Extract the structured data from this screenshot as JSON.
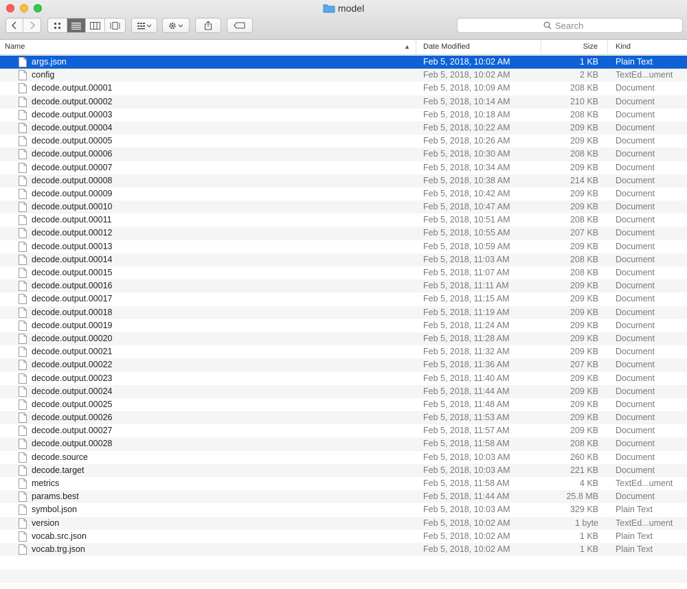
{
  "window": {
    "title": "model",
    "colors": {
      "selection": "#0f62d5",
      "close": "#fc605c",
      "minimize": "#fdbc40",
      "maximize": "#34c84a"
    }
  },
  "toolbar": {
    "back_icon": "chevron-left-icon",
    "forward_icon": "chevron-right-icon",
    "view_modes": [
      "icon-view-icon",
      "list-view-icon",
      "column-view-icon",
      "cover-flow-icon"
    ],
    "active_view": "list",
    "search_placeholder": "Search"
  },
  "columns": {
    "name": "Name",
    "date": "Date Modified",
    "size": "Size",
    "kind": "Kind"
  },
  "files": [
    {
      "name": "args.json",
      "date": "Feb 5, 2018, 10:02 AM",
      "size": "1 KB",
      "kind": "Plain Text",
      "selected": true
    },
    {
      "name": "config",
      "date": "Feb 5, 2018, 10:02 AM",
      "size": "2 KB",
      "kind": "TextEd...ument"
    },
    {
      "name": "decode.output.00001",
      "date": "Feb 5, 2018, 10:09 AM",
      "size": "208 KB",
      "kind": "Document"
    },
    {
      "name": "decode.output.00002",
      "date": "Feb 5, 2018, 10:14 AM",
      "size": "210 KB",
      "kind": "Document"
    },
    {
      "name": "decode.output.00003",
      "date": "Feb 5, 2018, 10:18 AM",
      "size": "208 KB",
      "kind": "Document"
    },
    {
      "name": "decode.output.00004",
      "date": "Feb 5, 2018, 10:22 AM",
      "size": "209 KB",
      "kind": "Document"
    },
    {
      "name": "decode.output.00005",
      "date": "Feb 5, 2018, 10:26 AM",
      "size": "209 KB",
      "kind": "Document"
    },
    {
      "name": "decode.output.00006",
      "date": "Feb 5, 2018, 10:30 AM",
      "size": "208 KB",
      "kind": "Document"
    },
    {
      "name": "decode.output.00007",
      "date": "Feb 5, 2018, 10:34 AM",
      "size": "209 KB",
      "kind": "Document"
    },
    {
      "name": "decode.output.00008",
      "date": "Feb 5, 2018, 10:38 AM",
      "size": "214 KB",
      "kind": "Document"
    },
    {
      "name": "decode.output.00009",
      "date": "Feb 5, 2018, 10:42 AM",
      "size": "209 KB",
      "kind": "Document"
    },
    {
      "name": "decode.output.00010",
      "date": "Feb 5, 2018, 10:47 AM",
      "size": "209 KB",
      "kind": "Document"
    },
    {
      "name": "decode.output.00011",
      "date": "Feb 5, 2018, 10:51 AM",
      "size": "208 KB",
      "kind": "Document"
    },
    {
      "name": "decode.output.00012",
      "date": "Feb 5, 2018, 10:55 AM",
      "size": "207 KB",
      "kind": "Document"
    },
    {
      "name": "decode.output.00013",
      "date": "Feb 5, 2018, 10:59 AM",
      "size": "209 KB",
      "kind": "Document"
    },
    {
      "name": "decode.output.00014",
      "date": "Feb 5, 2018, 11:03 AM",
      "size": "208 KB",
      "kind": "Document"
    },
    {
      "name": "decode.output.00015",
      "date": "Feb 5, 2018, 11:07 AM",
      "size": "208 KB",
      "kind": "Document"
    },
    {
      "name": "decode.output.00016",
      "date": "Feb 5, 2018, 11:11 AM",
      "size": "209 KB",
      "kind": "Document"
    },
    {
      "name": "decode.output.00017",
      "date": "Feb 5, 2018, 11:15 AM",
      "size": "209 KB",
      "kind": "Document"
    },
    {
      "name": "decode.output.00018",
      "date": "Feb 5, 2018, 11:19 AM",
      "size": "209 KB",
      "kind": "Document"
    },
    {
      "name": "decode.output.00019",
      "date": "Feb 5, 2018, 11:24 AM",
      "size": "209 KB",
      "kind": "Document"
    },
    {
      "name": "decode.output.00020",
      "date": "Feb 5, 2018, 11:28 AM",
      "size": "209 KB",
      "kind": "Document"
    },
    {
      "name": "decode.output.00021",
      "date": "Feb 5, 2018, 11:32 AM",
      "size": "209 KB",
      "kind": "Document"
    },
    {
      "name": "decode.output.00022",
      "date": "Feb 5, 2018, 11:36 AM",
      "size": "207 KB",
      "kind": "Document"
    },
    {
      "name": "decode.output.00023",
      "date": "Feb 5, 2018, 11:40 AM",
      "size": "209 KB",
      "kind": "Document"
    },
    {
      "name": "decode.output.00024",
      "date": "Feb 5, 2018, 11:44 AM",
      "size": "209 KB",
      "kind": "Document"
    },
    {
      "name": "decode.output.00025",
      "date": "Feb 5, 2018, 11:48 AM",
      "size": "209 KB",
      "kind": "Document"
    },
    {
      "name": "decode.output.00026",
      "date": "Feb 5, 2018, 11:53 AM",
      "size": "209 KB",
      "kind": "Document"
    },
    {
      "name": "decode.output.00027",
      "date": "Feb 5, 2018, 11:57 AM",
      "size": "209 KB",
      "kind": "Document"
    },
    {
      "name": "decode.output.00028",
      "date": "Feb 5, 2018, 11:58 AM",
      "size": "208 KB",
      "kind": "Document"
    },
    {
      "name": "decode.source",
      "date": "Feb 5, 2018, 10:03 AM",
      "size": "260 KB",
      "kind": "Document"
    },
    {
      "name": "decode.target",
      "date": "Feb 5, 2018, 10:03 AM",
      "size": "221 KB",
      "kind": "Document"
    },
    {
      "name": "metrics",
      "date": "Feb 5, 2018, 11:58 AM",
      "size": "4 KB",
      "kind": "TextEd...ument"
    },
    {
      "name": "params.best",
      "date": "Feb 5, 2018, 11:44 AM",
      "size": "25.8 MB",
      "kind": "Document"
    },
    {
      "name": "symbol.json",
      "date": "Feb 5, 2018, 10:03 AM",
      "size": "329 KB",
      "kind": "Plain Text"
    },
    {
      "name": "version",
      "date": "Feb 5, 2018, 10:02 AM",
      "size": "1 byte",
      "kind": "TextEd...ument"
    },
    {
      "name": "vocab.src.json",
      "date": "Feb 5, 2018, 10:02 AM",
      "size": "1 KB",
      "kind": "Plain Text"
    },
    {
      "name": "vocab.trg.json",
      "date": "Feb 5, 2018, 10:02 AM",
      "size": "1 KB",
      "kind": "Plain Text"
    }
  ]
}
